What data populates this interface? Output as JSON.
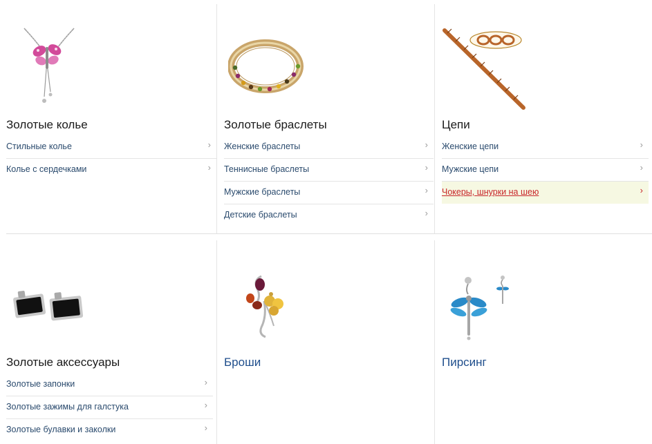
{
  "categories": [
    {
      "title": "Золотые колье",
      "image_icon": "butterfly-necklace-icon",
      "links": [
        "Стильные колье",
        "Колье с сердечками"
      ]
    },
    {
      "title": "Золотые браслеты",
      "image_icon": "gem-bracelet-icon",
      "links": [
        "Женские браслеты",
        "Теннисные браслеты",
        "Мужские браслеты",
        "Детские браслеты"
      ]
    },
    {
      "title": "Цепи",
      "image_icon": "chain-icon",
      "links": [
        "Женские цепи",
        "Мужские цепи",
        "Чокеры, шнурки на шею"
      ],
      "highlighted_link": "Чокеры, шнурки на шею"
    },
    {
      "title": "Золотые аксессуары",
      "image_icon": "cufflinks-icon",
      "links": [
        "Золотые запонки",
        "Золотые зажимы для галстука",
        "Золотые булавки и заколки"
      ]
    },
    {
      "title": "Броши",
      "image_icon": "brooch-icon",
      "links": []
    },
    {
      "title": "Пирсинг",
      "image_icon": "dragonfly-piercing-icon",
      "links": []
    }
  ],
  "chevron_glyph": "›",
  "colors": {
    "link": "#2a4a6d",
    "title_link": "#1f4e8c",
    "highlight_bg": "#f6f8e2",
    "highlight_text": "#c8262a"
  }
}
